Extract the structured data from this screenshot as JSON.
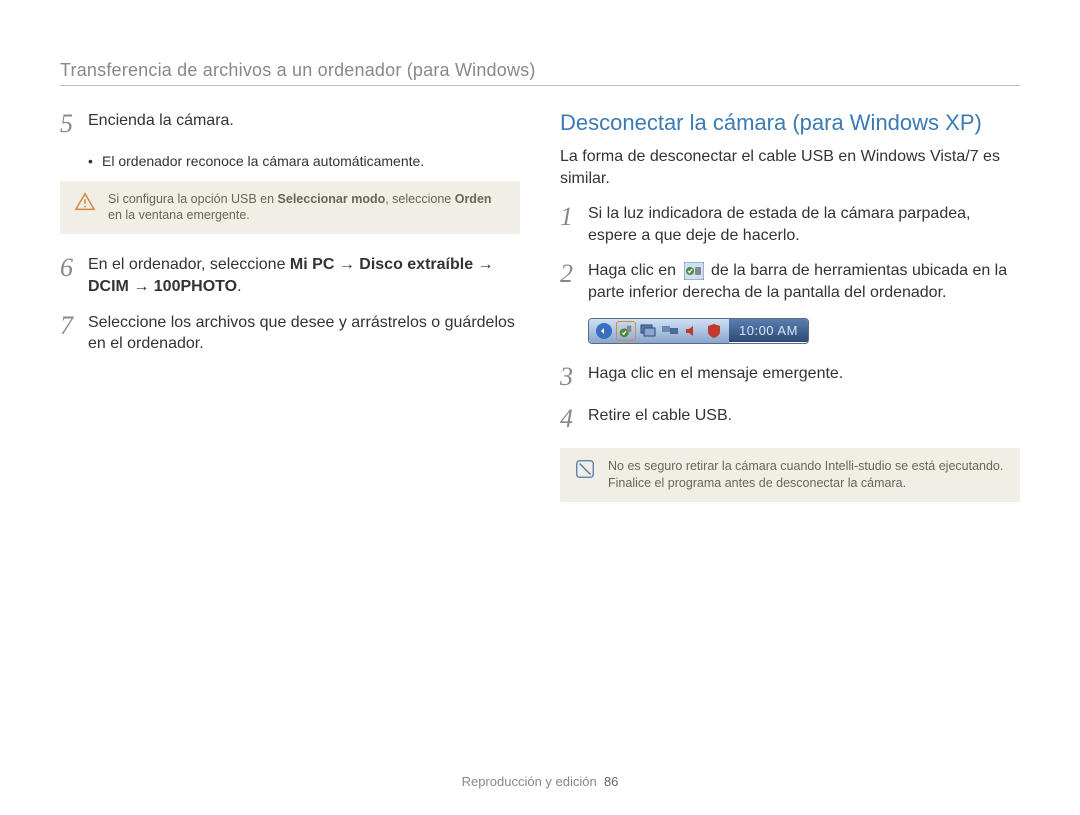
{
  "header": "Transferencia de archivos a un ordenador (para Windows)",
  "left": {
    "step5": {
      "num": "5",
      "text": "Encienda la cámara.",
      "bullet": "El ordenador reconoce la cámara automáticamente."
    },
    "note": {
      "pre": "Si configura la opción USB en ",
      "b1": "Seleccionar modo",
      "mid": ", seleccione ",
      "b2": "Orden",
      "post": " en la ventana emergente."
    },
    "step6": {
      "num": "6",
      "pre": "En el ordenador, seleccione ",
      "b1": "Mi PC",
      "arr": " → ",
      "b2": "Disco extraíble",
      "b3": "DCIM",
      "b4": "100PHOTO",
      "post": "."
    },
    "step7": {
      "num": "7",
      "text": "Seleccione los archivos que desee y arrástrelos o guárdelos en el ordenador."
    }
  },
  "right": {
    "title": "Desconectar la cámara (para Windows XP)",
    "intro": "La forma de desconectar el cable USB en Windows Vista/7 es similar.",
    "step1": {
      "num": "1",
      "text": "Si la luz indicadora de estada de la cámara parpadea, espere a que deje de hacerlo."
    },
    "step2": {
      "num": "2",
      "pre": "Haga clic en ",
      "post": " de la barra de herramientas ubicada en la parte inferior derecha de la pantalla del ordenador."
    },
    "tray_time": "10:00 AM",
    "step3": {
      "num": "3",
      "text": "Haga clic en el mensaje emergente."
    },
    "step4": {
      "num": "4",
      "text": "Retire el cable USB."
    },
    "note": "No es seguro retirar la cámara cuando Intelli-studio se está ejecutando. Finalice el programa antes de desconectar la cámara."
  },
  "footer": {
    "section": "Reproducción y edición",
    "page": "86"
  }
}
